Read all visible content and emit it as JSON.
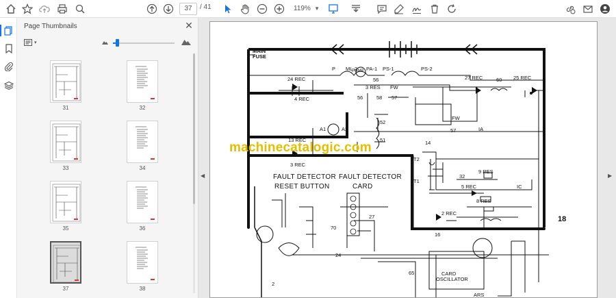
{
  "toolbar": {
    "current_page": "37",
    "total_pages": "/ 41",
    "zoom": "119%",
    "icons": [
      "home-icon",
      "star-icon",
      "cloud-upload-icon",
      "print-icon",
      "zoom-search-icon",
      "page-up-icon",
      "page-down-icon",
      "select-cursor-icon",
      "hand-icon",
      "zoom-out-icon",
      "zoom-in-icon",
      "fit-page-icon",
      "scroll-mode-icon",
      "comment-icon",
      "highlight-pen-icon",
      "sign-icon",
      "delete-icon",
      "rotate-icon",
      "share-link-icon",
      "email-icon",
      "account-icon"
    ]
  },
  "panel": {
    "title": "Page Thumbnails",
    "thumbnails": [
      {
        "num": "31"
      },
      {
        "num": "32"
      },
      {
        "num": "33"
      },
      {
        "num": "34"
      },
      {
        "num": "35"
      },
      {
        "num": "36"
      },
      {
        "num": "37"
      },
      {
        "num": "38"
      }
    ],
    "selected": "37"
  },
  "document": {
    "watermark": "machinecatalogic.com",
    "labels": {
      "main_fuse_1": "MAIN",
      "main_fuse_2": "FUSE",
      "fault_detector_reset": "FAULT DETECTOR",
      "reset_button": "RESET BUTTON",
      "fault_detector_card": "FAULT DETECTOR",
      "card": "CARD",
      "rec24": "24 REC",
      "rec4": "4 REC",
      "rec13": "13 REC",
      "rec3": "3 REC",
      "rec27": "27 REC",
      "rec25": "25 REC",
      "res3": "3 RES",
      "res9": "9 RES",
      "res8": "8 RES",
      "rec5": "5 REC",
      "rec2": "2 REC",
      "fw": "FW",
      "pump": "PUMP",
      "p": "P",
      "ml2": "ML-2",
      "pa1": "PA-1",
      "ps1": "PS-1",
      "ps2": "PS-2",
      "n56": "56",
      "n58": "58",
      "n57": "57",
      "n60": "60",
      "n52": "52",
      "n51": "51",
      "a1": "A1",
      "a2": "A2",
      "ia": "IA",
      "n14": "14",
      "t2": "T2",
      "t1": "T1",
      "n32": "32",
      "ic": "IC",
      "n16": "16",
      "n24": "24",
      "n27": "27",
      "n70": "70",
      "n18": "18",
      "card_oscillator_1": "CARD",
      "card_oscillator_2": "OSCILLATOR",
      "ars": "ARS",
      "n65": "65",
      "n2": "2"
    }
  }
}
